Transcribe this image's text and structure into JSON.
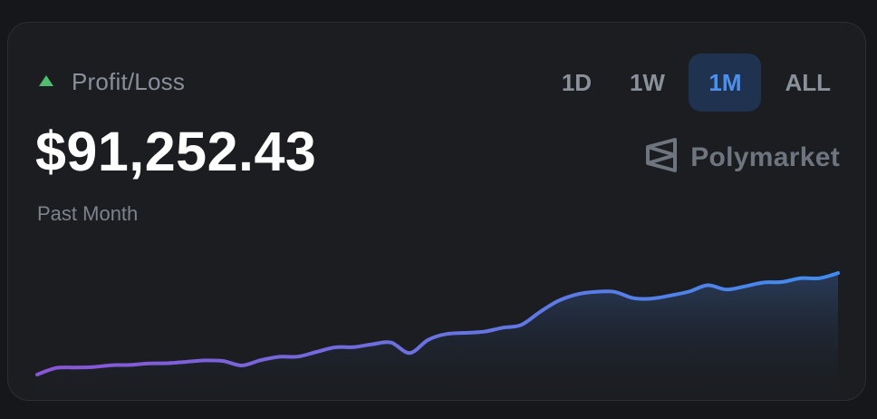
{
  "header": {
    "label": "Profit/Loss",
    "trend": "up",
    "trend_color": "#4fbf6f"
  },
  "amount": "$91,252.43",
  "period": "Past Month",
  "tabs": [
    {
      "label": "1D",
      "active": false
    },
    {
      "label": "1W",
      "active": false
    },
    {
      "label": "1M",
      "active": true
    },
    {
      "label": "ALL",
      "active": false
    }
  ],
  "brand": {
    "name": "Polymarket",
    "icon": "polymarket-logo-icon"
  },
  "colors": {
    "accent": "#4d90ec",
    "line_start": "#8a55d6",
    "line_end": "#3f8cf0",
    "card_bg": "#1b1d21"
  },
  "chart_data": {
    "type": "area",
    "title": "",
    "xlabel": "",
    "ylabel": "",
    "values": [
      0,
      0.061,
      0.066,
      0.07,
      0.087,
      0.09,
      0.104,
      0.106,
      0.119,
      0.132,
      0.126,
      0.085,
      0.134,
      0.166,
      0.168,
      0.212,
      0.254,
      0.257,
      0.283,
      0.299,
      0.202,
      0.325,
      0.38,
      0.39,
      0.401,
      0.438,
      0.464,
      0.586,
      0.69,
      0.75,
      0.773,
      0.773,
      0.714,
      0.71,
      0.739,
      0.775,
      0.835,
      0.795,
      0.824,
      0.86,
      0.865,
      0.9,
      0.9,
      0.948
    ]
  }
}
